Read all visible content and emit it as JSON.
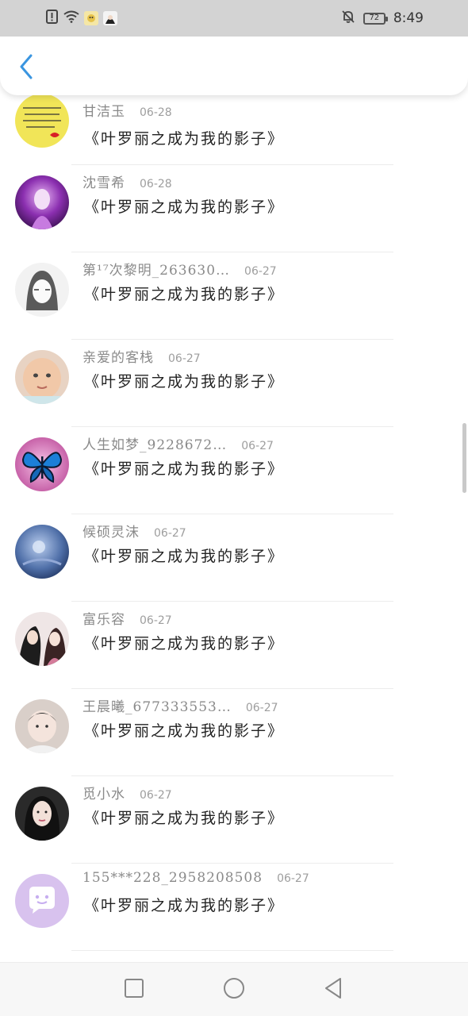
{
  "status_bar": {
    "time": "8:49",
    "battery": "72",
    "icons": [
      "alert-icon",
      "wifi-icon",
      "app-avatar-icon",
      "app-avatar-icon",
      "bell-muted-icon"
    ]
  },
  "header": {
    "back_icon": "chevron-left-icon",
    "accent": "#3a95e0"
  },
  "messages": [
    {
      "name": "甘洁玉",
      "date": "06-28",
      "text": "《叶罗丽之成为我的影子》"
    },
    {
      "name": "沈雪希",
      "date": "06-28",
      "text": "《叶罗丽之成为我的影子》"
    },
    {
      "name": "第¹⁷次黎明_263630…",
      "date": "06-27",
      "text": "《叶罗丽之成为我的影子》"
    },
    {
      "name": "亲爱的客栈",
      "date": "06-27",
      "text": "《叶罗丽之成为我的影子》"
    },
    {
      "name": "人生如梦_9228672…",
      "date": "06-27",
      "text": "《叶罗丽之成为我的影子》"
    },
    {
      "name": "候硕灵沫",
      "date": "06-27",
      "text": "《叶罗丽之成为我的影子》"
    },
    {
      "name": "富乐容",
      "date": "06-27",
      "text": "《叶罗丽之成为我的影子》"
    },
    {
      "name": "王晨曦_677333553…",
      "date": "06-27",
      "text": "《叶罗丽之成为我的影子》"
    },
    {
      "name": "觅小水",
      "date": "06-27",
      "text": "《叶罗丽之成为我的影子》"
    },
    {
      "name": "155***228_2958208508",
      "date": "06-27",
      "text": "《叶罗丽之成为我的影子》"
    }
  ],
  "nav_bar": {
    "icons": [
      "recent-apps-icon",
      "home-icon",
      "back-icon"
    ]
  }
}
